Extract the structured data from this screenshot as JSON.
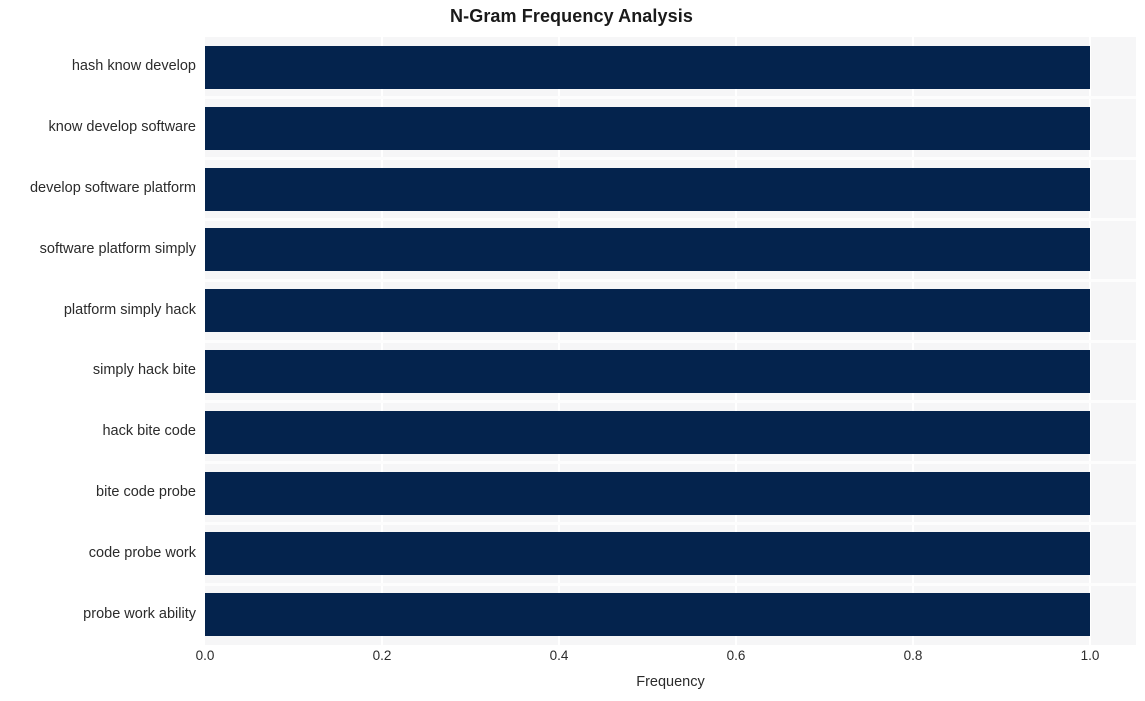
{
  "chart_data": {
    "type": "bar",
    "orientation": "horizontal",
    "title": "N-Gram Frequency Analysis",
    "xlabel": "Frequency",
    "ylabel": "",
    "xlim": [
      0.0,
      1.0
    ],
    "xticks": [
      "0.0",
      "0.2",
      "0.4",
      "0.6",
      "0.8",
      "1.0"
    ],
    "xtick_values": [
      0.0,
      0.2,
      0.4,
      0.6,
      0.8,
      1.0
    ],
    "grid": "vertical-white-on-gray",
    "legend": null,
    "bar_color": "#04234d",
    "plot_background": "#f6f6f7",
    "figure_background": "#ffffff",
    "categories": [
      "hash know develop",
      "know develop software",
      "develop software platform",
      "software platform simply",
      "platform simply hack",
      "simply hack bite",
      "hack bite code",
      "bite code probe",
      "code probe work",
      "probe work ability"
    ],
    "values": [
      1.0,
      1.0,
      1.0,
      1.0,
      1.0,
      1.0,
      1.0,
      1.0,
      1.0,
      1.0
    ]
  }
}
